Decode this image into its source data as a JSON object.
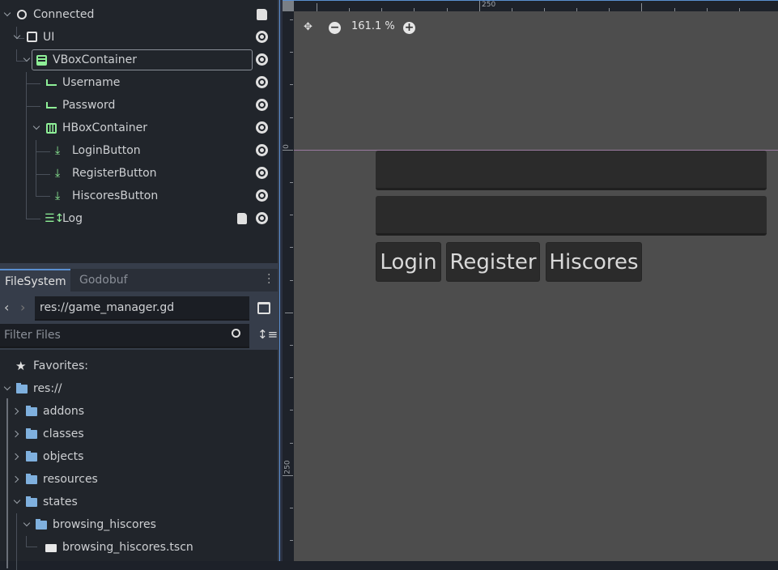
{
  "scene_tree": [
    {
      "name": "Connected",
      "icon": "node-circle-icon",
      "script": true,
      "eye": false
    },
    {
      "name": "UI",
      "icon": "control-icon",
      "eye": true
    },
    {
      "name": "VBoxContainer",
      "icon": "vbox-icon",
      "eye": true,
      "selected": true
    },
    {
      "name": "Username",
      "icon": "line-edit-icon",
      "eye": true
    },
    {
      "name": "Password",
      "icon": "line-edit-icon",
      "eye": true
    },
    {
      "name": "HBoxContainer",
      "icon": "hbox-icon",
      "eye": true
    },
    {
      "name": "LoginButton",
      "icon": "button-icon",
      "eye": true
    },
    {
      "name": "RegisterButton",
      "icon": "button-icon",
      "eye": true
    },
    {
      "name": "HiscoresButton",
      "icon": "button-icon",
      "eye": true
    },
    {
      "name": "Log",
      "icon": "rich-text-icon",
      "script": true,
      "eye": true
    }
  ],
  "dock_tabs": [
    "FileSystem",
    "Godobuf"
  ],
  "path": "res://game_manager.gd",
  "filter_placeholder": "Filter Files",
  "files": {
    "favorites": "Favorites:",
    "root": "res://",
    "items": [
      "addons",
      "classes",
      "objects",
      "resources",
      "states",
      "browsing_hiscores",
      "browsing_hiscores.tscn"
    ]
  },
  "viewport": {
    "zoom": "161.1 %",
    "ruler_top": "250",
    "ruler_left": [
      "0",
      "250"
    ],
    "buttons": [
      "Login",
      "Register",
      "Hiscores"
    ]
  },
  "colors": {
    "accent": "#5a8fd0",
    "node_green": "#8eef97",
    "folder": "#7fb0de"
  }
}
